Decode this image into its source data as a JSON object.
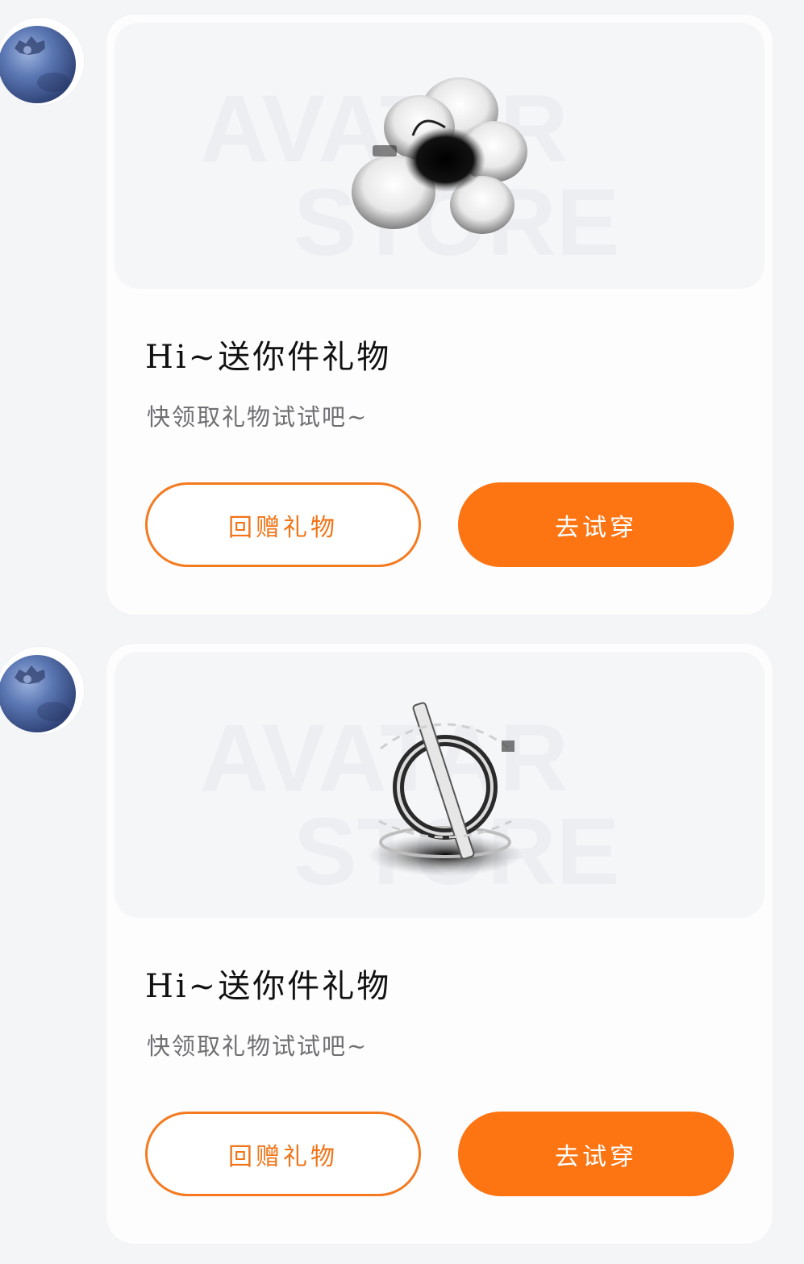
{
  "messages": [
    {
      "gift_item": "flower-hair-clip",
      "title": "Hi~送你件礼物",
      "subtitle": "快领取礼物试试吧~",
      "return_gift_label": "回赠礼物",
      "try_on_label": "去试穿",
      "watermark": [
        "AVATAR",
        "STORE"
      ]
    },
    {
      "gift_item": "crystal-ring-emblem",
      "title": "Hi~送你件礼物",
      "subtitle": "快领取礼物试试吧~",
      "return_gift_label": "回赠礼物",
      "try_on_label": "去试穿",
      "watermark": [
        "AVATAR",
        "STORE"
      ]
    }
  ],
  "colors": {
    "accent": "#fd7412",
    "accent_text": "#f07418",
    "page_background": "#f4f5f7",
    "card_background": "#fdfdfe",
    "title_text": "#111111",
    "subtitle_text": "#6f6f73"
  }
}
